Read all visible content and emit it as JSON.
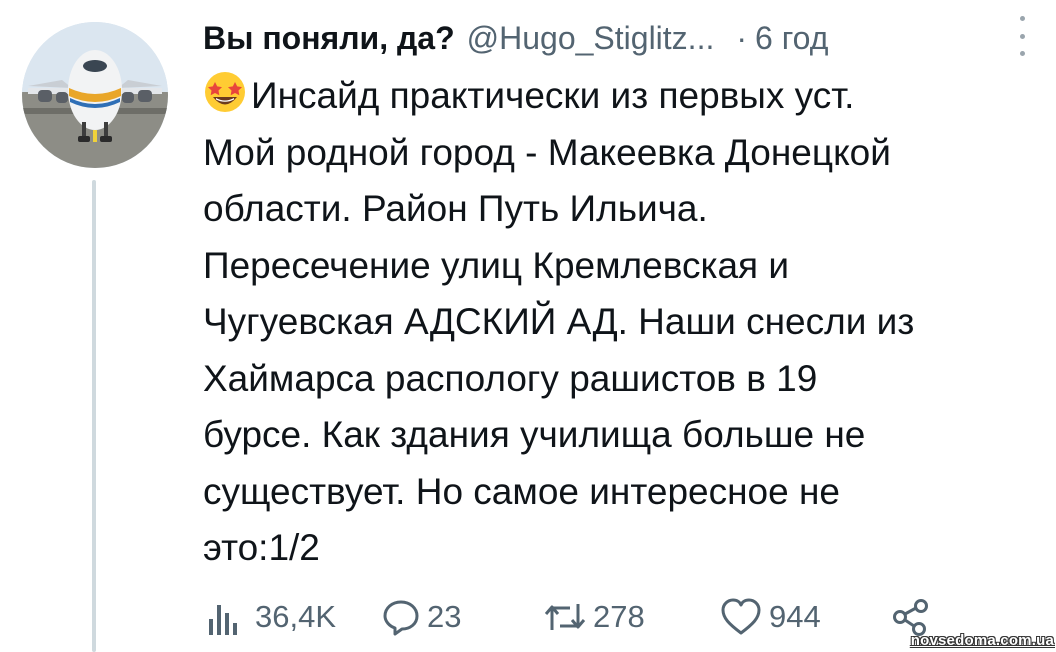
{
  "tweet": {
    "display_name": "Вы поняли, да?",
    "handle": "@Hugo_Stiglitz...",
    "separator": "·",
    "time": "6 год",
    "emoji": "star-struck-emoji",
    "text": "Инсайд практически из первых уст.\nМой родной город - Макеевка Донецкой\nобласти. Район Путь Ильича.\nПересечение улиц Кремлевская и\nЧугуевская АДСКИЙ АД. Наши снесли из\nХаймарса распологу рашистов в 19\nбурсе. Как здания училища больше не\nсуществует. Но самое интересное не\nэто:1/2"
  },
  "actions": {
    "views": {
      "icon": "views-icon",
      "count": "36,4K"
    },
    "replies": {
      "icon": "reply-icon",
      "count": "23"
    },
    "retweets": {
      "icon": "retweet-icon",
      "count": "278"
    },
    "likes": {
      "icon": "heart-icon",
      "count": "944"
    },
    "share": {
      "icon": "share-icon"
    }
  },
  "watermark": "novsedoma.com.ua",
  "colors": {
    "text": "#0f1419",
    "secondary": "#536471",
    "thread_line": "#cfd9de"
  }
}
